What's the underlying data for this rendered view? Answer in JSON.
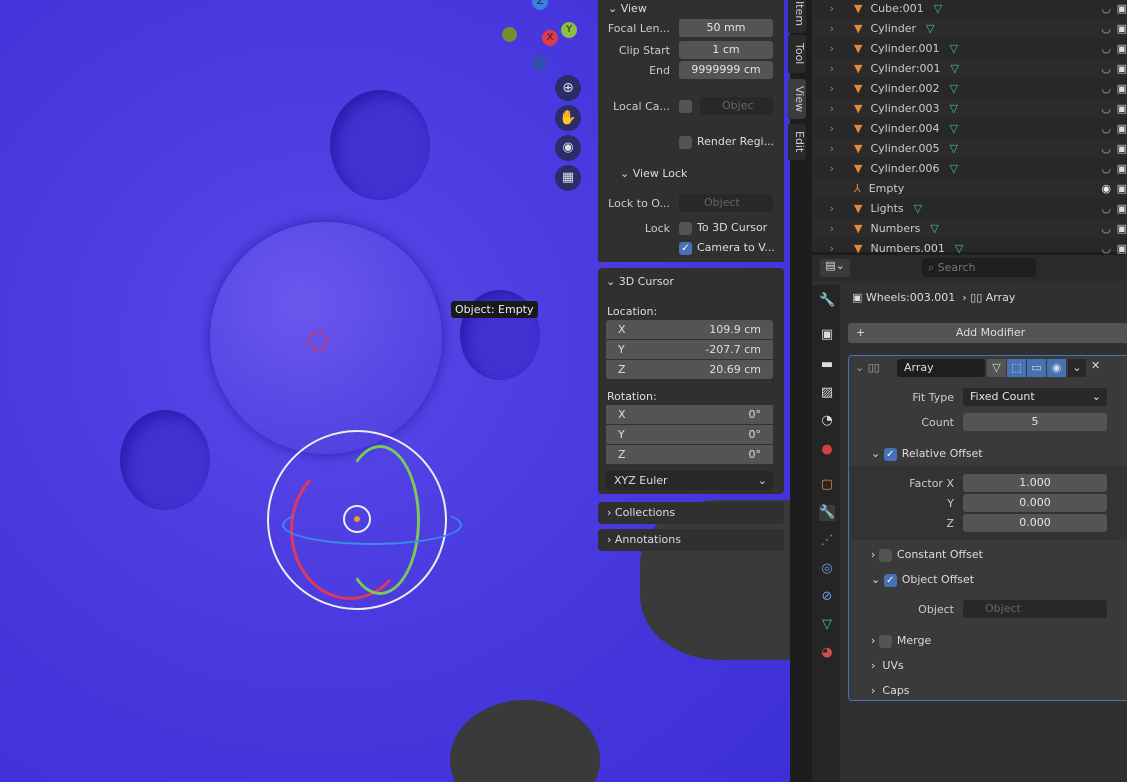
{
  "viewport": {
    "tooltip": "Object: Empty",
    "gizmo_axes": {
      "x": "X",
      "y": "Y",
      "z": "Z"
    }
  },
  "npanel": {
    "view_header": "View",
    "focal_length_label": "Focal Len...",
    "focal_length": "50 mm",
    "clip_start_label": "Clip Start",
    "clip_start": "1 cm",
    "clip_end_label": "End",
    "clip_end": "9999999 cm",
    "local_camera_label": "Local Ca...",
    "local_camera_placeholder": "Objec",
    "render_region_label": "Render Regi...",
    "view_lock_header": "View Lock",
    "lock_to_object_label": "Lock to O...",
    "lock_to_object_placeholder": "Object",
    "lock_label": "Lock",
    "to_3d_cursor": "To 3D Cursor",
    "camera_to_view": "Camera to V...",
    "cursor_header": "3D Cursor",
    "location_label": "Location:",
    "location": [
      {
        "axis": "X",
        "value": "109.9 cm"
      },
      {
        "axis": "Y",
        "value": "-207.7 cm"
      },
      {
        "axis": "Z",
        "value": "20.69 cm"
      }
    ],
    "rotation_label": "Rotation:",
    "rotation": [
      {
        "axis": "X",
        "value": "0°"
      },
      {
        "axis": "Y",
        "value": "0°"
      },
      {
        "axis": "Z",
        "value": "0°"
      }
    ],
    "rotation_mode": "XYZ Euler",
    "collections": "Collections",
    "annotations": "Annotations"
  },
  "tabs": [
    "Item",
    "Tool",
    "View",
    "Edit"
  ],
  "outliner": [
    {
      "name": "Cube:001",
      "type": "mesh"
    },
    {
      "name": "Cylinder",
      "type": "mesh"
    },
    {
      "name": "Cylinder.001",
      "type": "mesh"
    },
    {
      "name": "Cylinder:001",
      "type": "mesh"
    },
    {
      "name": "Cylinder.002",
      "type": "mesh"
    },
    {
      "name": "Cylinder.003",
      "type": "mesh"
    },
    {
      "name": "Cylinder.004",
      "type": "mesh"
    },
    {
      "name": "Cylinder.005",
      "type": "mesh"
    },
    {
      "name": "Cylinder.006",
      "type": "mesh"
    },
    {
      "name": "Empty",
      "type": "empty"
    },
    {
      "name": "Lights",
      "type": "mesh"
    },
    {
      "name": "Numbers",
      "type": "mesh"
    },
    {
      "name": "Numbers.001",
      "type": "mesh"
    }
  ],
  "properties": {
    "search_placeholder": "Search",
    "breadcrumb_object": "Wheels:003.001",
    "breadcrumb_modifier": "Array",
    "add_modifier": "Add Modifier",
    "modifier_name": "Array",
    "fit_type_label": "Fit Type",
    "fit_type": "Fixed Count",
    "count_label": "Count",
    "count": "5",
    "relative_offset": "Relative Offset",
    "factor_x_label": "Factor X",
    "factor_x": "1.000",
    "factor_y_label": "Y",
    "factor_y": "0.000",
    "factor_z_label": "Z",
    "factor_z": "0.000",
    "constant_offset": "Constant Offset",
    "object_offset": "Object Offset",
    "object_label": "Object",
    "object_placeholder": "Object",
    "merge": "Merge",
    "uvs": "UVs",
    "caps": "Caps"
  },
  "colors": {
    "accent": "#4772b3",
    "viewport": "#4a3be0",
    "mesh_icon": "#e0883a",
    "vertex_icon": "#3ec9a0"
  }
}
